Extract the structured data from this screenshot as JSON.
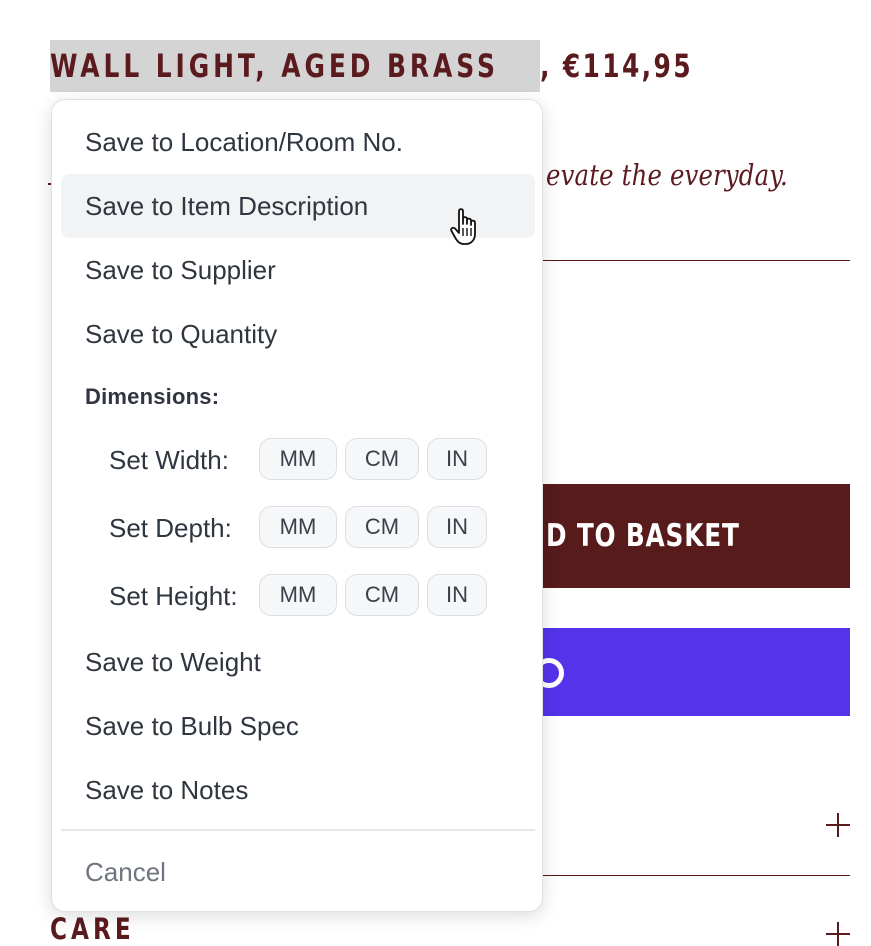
{
  "product": {
    "title_selected": "WALL LIGHT, AGED BRASS",
    "title_rest": ", €114,95",
    "tagline": "evate the everyday.",
    "add_to_basket": "D TO BASKET",
    "care_label": "CARE"
  },
  "menu": {
    "items_top": [
      "Save to Location/Room No.",
      "Save to Item Description",
      "Save to Supplier",
      "Save to Quantity"
    ],
    "hovered_item": "Save to Item Description",
    "dimensions_label": "Dimensions:",
    "dimension_rows": [
      {
        "label": "Set Width:",
        "units": [
          "MM",
          "CM",
          "IN"
        ]
      },
      {
        "label": "Set Depth:",
        "units": [
          "MM",
          "CM",
          "IN"
        ]
      },
      {
        "label": "Set Height:",
        "units": [
          "MM",
          "CM",
          "IN"
        ]
      }
    ],
    "items_bottom": [
      "Save to Weight",
      "Save to Bulb Spec",
      "Save to Notes"
    ],
    "cancel": "Cancel"
  },
  "icons": {
    "cursor": "hand-pointer-icon",
    "expand": "plus-icon"
  },
  "colors": {
    "brand_text": "#5a1a1e",
    "basket_button": "#571b1c",
    "shop_button": "#5433eb",
    "selection_highlight": "#d4d4d4"
  }
}
